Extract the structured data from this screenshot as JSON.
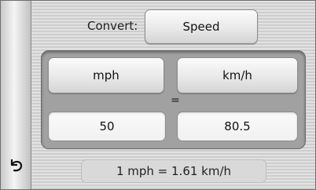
{
  "sidebar": {
    "back_icon": "back-arrow-icon"
  },
  "converter": {
    "convert_label": "Convert:",
    "category": "Speed",
    "unit_from": "mph",
    "unit_to": "km/h",
    "equals": "=",
    "value_from": "50",
    "value_to": "80.5",
    "rate": "1 mph = 1.61 km/h"
  }
}
